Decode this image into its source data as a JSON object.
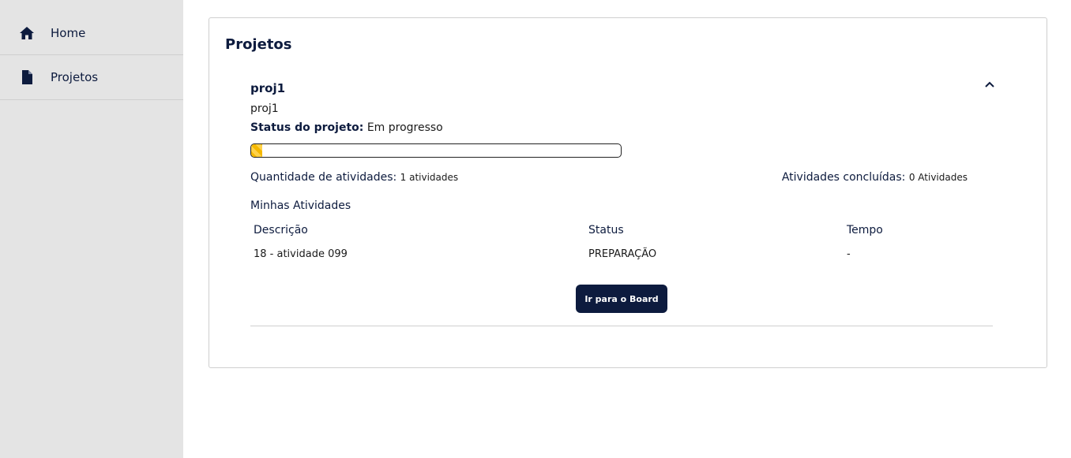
{
  "sidebar": {
    "items": [
      {
        "label": "Home",
        "icon": "home-icon"
      },
      {
        "label": "Projetos",
        "icon": "document-icon"
      }
    ]
  },
  "main": {
    "title": "Projetos",
    "project": {
      "name": "proj1",
      "description": "proj1",
      "status_key": "Status do projeto:",
      "status_value": "Em progresso",
      "progress": 0.03,
      "qty_key": "Quantidade de atividades:",
      "qty_value": "1 atividades",
      "done_key": "Atividades concluídas:",
      "done_value": "0 Atividades",
      "activities_title": "Minhas Atividades",
      "table": {
        "headers": [
          "Descrição",
          "Status",
          "Tempo"
        ],
        "rows": [
          [
            "18 - atividade 099",
            "PREPARAÇÃO",
            "-"
          ]
        ]
      },
      "board_button": "Ir para o Board"
    }
  },
  "colors": {
    "primary": "#0d1b3e",
    "progress": "#f5b800",
    "sidebar_bg": "#e4e4e4"
  }
}
